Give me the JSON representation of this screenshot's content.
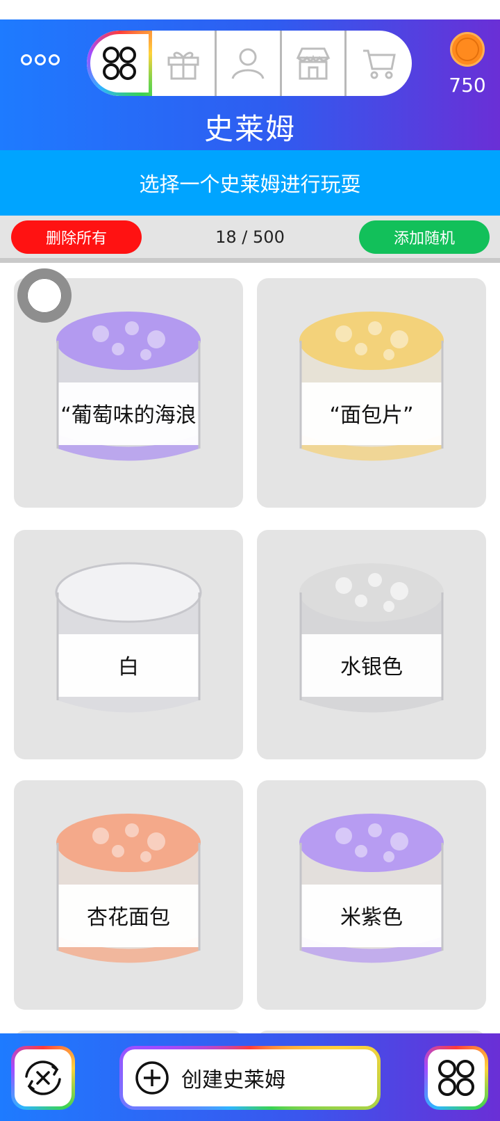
{
  "header": {
    "title": "史莱姆",
    "coins": "750",
    "tabs": [
      {
        "name": "collection",
        "icon": "four-circles-icon"
      },
      {
        "name": "gift",
        "icon": "gift-icon"
      },
      {
        "name": "profile",
        "icon": "user-icon"
      },
      {
        "name": "shop",
        "icon": "store-icon"
      },
      {
        "name": "cart",
        "icon": "cart-icon"
      }
    ]
  },
  "subtitle": "选择一个史莱姆进行玩耍",
  "toolbar": {
    "delete_all": "删除所有",
    "count": "18 / 500",
    "add_random": "添加随机"
  },
  "slimes": [
    {
      "label": "“葡萄味的海浪",
      "color": "#b39af0"
    },
    {
      "label": "“面包片”",
      "color": "#f3d27a"
    },
    {
      "label": "白",
      "color": "#f2f2f4"
    },
    {
      "label": "水银色",
      "color": "#dcdcdc"
    },
    {
      "label": "杏花面包",
      "color": "#f4a98a"
    },
    {
      "label": "米紫色",
      "color": "#b79cf2"
    }
  ],
  "bottom": {
    "create": "创建史莱姆"
  },
  "colors": {
    "accent": "#1e7bff",
    "delete": "#ff1212",
    "add": "#12c05a"
  }
}
